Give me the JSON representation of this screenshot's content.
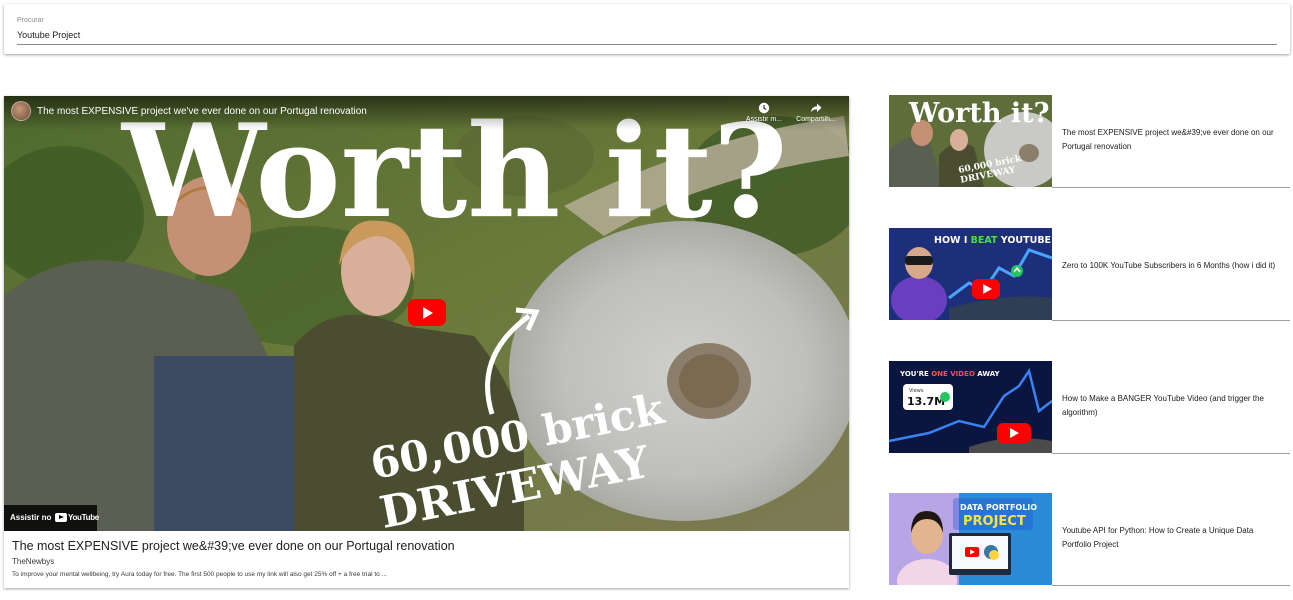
{
  "search": {
    "label": "Procurar",
    "value": "Youtube Project"
  },
  "player": {
    "title": "The most EXPENSIVE project we've ever done on our Portugal renovation",
    "actions": [
      {
        "icon": "clock-icon",
        "label": "Assistir m..."
      },
      {
        "icon": "share-icon",
        "label": "Compartilh..."
      }
    ],
    "watch_on": "Assistir no",
    "watch_on_brand": "YouTube",
    "thumbnail_text": {
      "headline": "Worth it?",
      "line1": "60,000 brick",
      "line2": "DRIVEWAY"
    }
  },
  "main_video": {
    "title": "The most EXPENSIVE project we&#39;ve ever done on our Portugal renovation",
    "channel": "TheNewbys",
    "description": "To improve your mental wellbeing, try Aura today for free. The first 500 people to use my link will also get 25% off + a free trial to ..."
  },
  "related": [
    {
      "title": "The most EXPENSIVE project we&#39;ve ever done on our Portugal renovation",
      "thumb_text": {
        "headline": "Worth it?",
        "line1": "60,000 brick",
        "line2": "DRIVEWAY"
      }
    },
    {
      "title": "Zero to 100K YouTube Subscribers in 6 Months (how i did it)",
      "thumb_text": {
        "pre": "HOW I ",
        "highlight": "BEAT",
        "post": " YOUTUBE"
      }
    },
    {
      "title": "How to Make a BANGER YouTube Video (and trigger the algorithm)",
      "thumb_text": {
        "pre": "YOU'RE ",
        "highlight": "ONE VIDEO",
        "post": " AWAY",
        "stat_label": "Views",
        "stat": "13.7M"
      }
    },
    {
      "title": "Youtube API for Python: How to Create a Unique Data Portfolio Project",
      "thumb_text": {
        "line1": "DATA PORTFOLIO",
        "line2": "PROJECT"
      }
    }
  ],
  "colors": {
    "youtube_red": "#ff0000",
    "thumb2_bg": "#1d2f7a",
    "thumb3_bg": "#0b1640",
    "thumb4_bg": "#2a8bd8"
  }
}
